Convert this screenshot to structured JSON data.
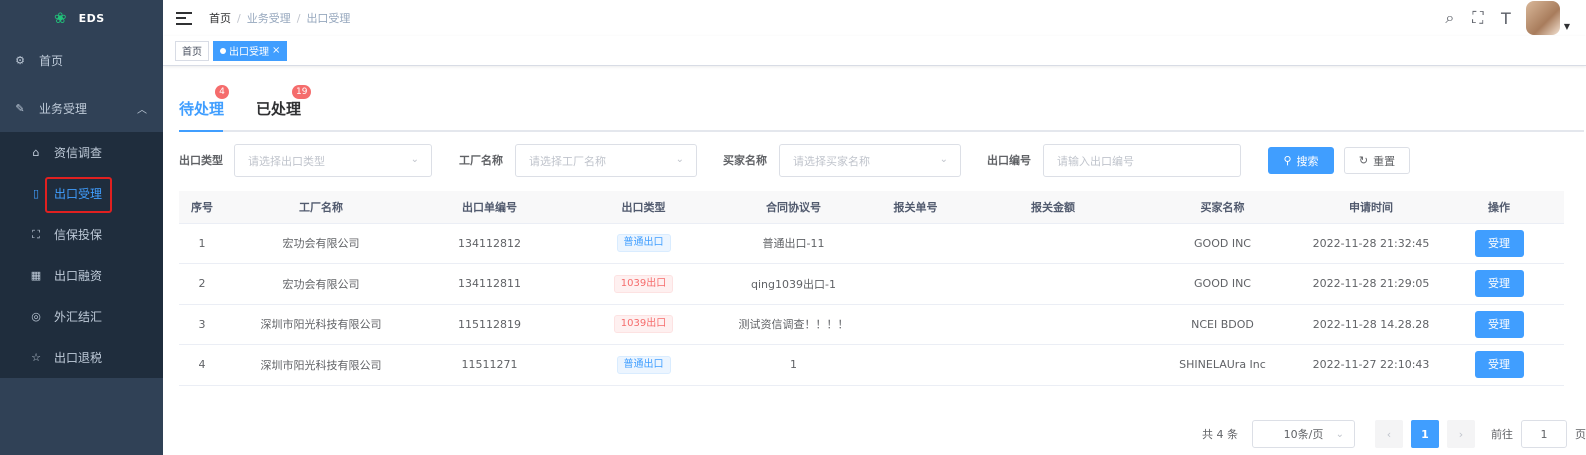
{
  "app": {
    "logo_text": "EDS"
  },
  "sidebar": {
    "items": [
      {
        "label": "首页",
        "icon": "dashboard-icon",
        "glyph": "⚙"
      },
      {
        "label": "业务受理",
        "icon": "edit-icon",
        "glyph": "✎",
        "expanded": true,
        "children": [
          {
            "label": "资信调查",
            "icon": "home-icon",
            "glyph": "⌂"
          },
          {
            "label": "出口受理",
            "icon": "document-icon",
            "glyph": "▯",
            "active": true
          },
          {
            "label": "信保投保",
            "icon": "expand-icon",
            "glyph": "⛶"
          },
          {
            "label": "出口融资",
            "icon": "bank-icon",
            "glyph": "▦"
          },
          {
            "label": "外汇结汇",
            "icon": "money-icon",
            "glyph": "◎"
          },
          {
            "label": "出口退税",
            "icon": "star-icon",
            "glyph": "☆"
          }
        ]
      }
    ]
  },
  "navbar": {
    "breadcrumb": [
      "首页",
      "业务受理",
      "出口受理"
    ],
    "separator": "/"
  },
  "tags_view": {
    "tags": [
      {
        "label": "首页",
        "active": false
      },
      {
        "label": "出口受理",
        "active": true,
        "close": "×"
      }
    ]
  },
  "tabs": [
    {
      "label": "待处理",
      "badge": "4",
      "active": true
    },
    {
      "label": "已处理",
      "badge": "19",
      "active": false
    }
  ],
  "filters": {
    "export_type": {
      "label": "出口类型",
      "placeholder": "请选择出口类型"
    },
    "factory": {
      "label": "工厂名称",
      "placeholder": "请选择工厂名称"
    },
    "buyer": {
      "label": "买家名称",
      "placeholder": "请选择买家名称"
    },
    "export_no": {
      "label": "出口编号",
      "placeholder": "请输入出口编号"
    },
    "search_label": "搜索",
    "reset_label": "重置"
  },
  "table": {
    "columns": [
      "序号",
      "工厂名称",
      "出口单编号",
      "出口类型",
      "合同协议号",
      "报关单号",
      "报关金额",
      "买家名称",
      "申请时间",
      "操作"
    ],
    "rows": [
      {
        "index": "1",
        "factory": "宏功会有限公司",
        "export_no": "134112812",
        "type": "普通出口",
        "type_style": "info",
        "contract": "普通出口-11",
        "customs_no": "",
        "customs_amount": "",
        "buyer": "GOOD INC",
        "time": "2022-11-28 21:32:45",
        "action": "受理"
      },
      {
        "index": "2",
        "factory": "宏功会有限公司",
        "export_no": "134112811",
        "type": "1039出口",
        "type_style": "danger",
        "contract": "qing1039出口-1",
        "customs_no": "",
        "customs_amount": "",
        "buyer": "GOOD INC",
        "time": "2022-11-28 21:29:05",
        "action": "受理"
      },
      {
        "index": "3",
        "factory": "深圳市阳光科技有限公司",
        "export_no": "115112819",
        "type": "1039出口",
        "type_style": "danger",
        "contract": "测试资信调查！！！！",
        "customs_no": "",
        "customs_amount": "",
        "buyer": "NCEI BDOD",
        "time": "2022-11-28 14.28.28",
        "action": "受理"
      },
      {
        "index": "4",
        "factory": "深圳市阳光科技有限公司",
        "export_no": "11511271",
        "type": "普通出口",
        "type_style": "info",
        "contract": "1",
        "customs_no": "",
        "customs_amount": "",
        "buyer": "SHINELAUra Inc",
        "time": "2022-11-27 22:10:43",
        "action": "受理"
      }
    ]
  },
  "pagination": {
    "total": "共 4 条",
    "page_size": "10条/页",
    "prev": "‹",
    "current": "1",
    "next": "›",
    "goto_label": "前往",
    "goto_value": "1",
    "page_unit": "页"
  }
}
